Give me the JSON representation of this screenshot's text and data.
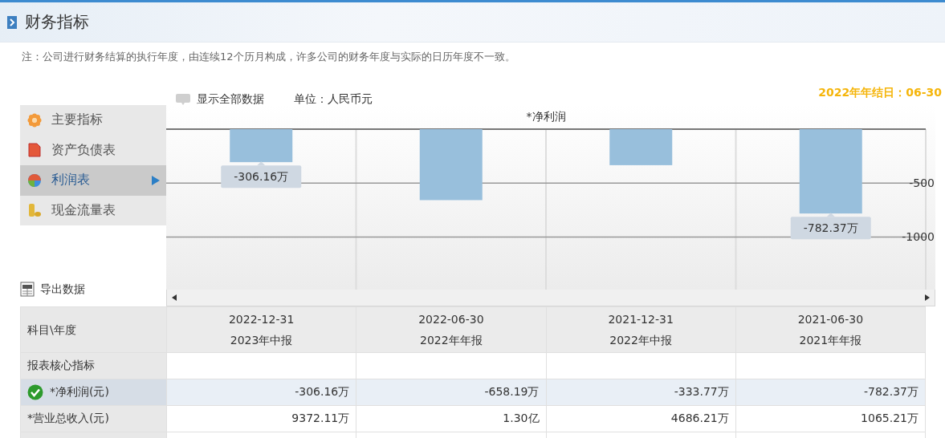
{
  "header": {
    "title": "财务指标"
  },
  "note": "注：公司进行财务结算的执行年度，由连续12个历月构成，许多公司的财务年度与实际的日历年度不一致。",
  "toolbar": {
    "show_all": "显示全部数据",
    "unit": "单位：人民币元",
    "year_end": "2022年年结日：06-30"
  },
  "sidebar": {
    "items": [
      {
        "label": "主要指标",
        "kind": "flower",
        "selected": false
      },
      {
        "label": "资产负债表",
        "kind": "document",
        "selected": false
      },
      {
        "label": "利润表",
        "kind": "ball",
        "selected": true
      },
      {
        "label": "现金流量表",
        "kind": "coins",
        "selected": false
      }
    ]
  },
  "chart": {
    "chart_data": {
      "type": "bar",
      "title": "*净利润",
      "values": [
        -306,
        -658,
        -334,
        -782
      ],
      "ylim": [
        -1480,
        0
      ],
      "yticks": [
        -500,
        -1000
      ],
      "annotations": [
        {
          "text": "-306.16万",
          "y": -306
        },
        {
          "text": "-782.37万",
          "y": -782
        }
      ]
    }
  },
  "export": "导出数据",
  "table": {
    "corner": "科目\\年度",
    "columns": [
      {
        "date": "2022-12-31",
        "report": "2023年中报"
      },
      {
        "date": "2022-06-30",
        "report": "2022年年报"
      },
      {
        "date": "2021-12-31",
        "report": "2022年中报"
      },
      {
        "date": "2021-06-30",
        "report": "2021年年报"
      }
    ],
    "rows": [
      {
        "kind": "section",
        "label": "报表核心指标"
      },
      {
        "kind": "metric",
        "label": "*净利润(元)",
        "selected": true,
        "cells": [
          "-306.16万",
          "-658.19万",
          "-333.77万",
          "-782.37万"
        ]
      },
      {
        "kind": "metric",
        "label": "*营业总收入(元)",
        "selected": false,
        "cells": [
          "9372.11万",
          "1.30亿",
          "4686.21万",
          "1065.21万"
        ]
      }
    ]
  }
}
